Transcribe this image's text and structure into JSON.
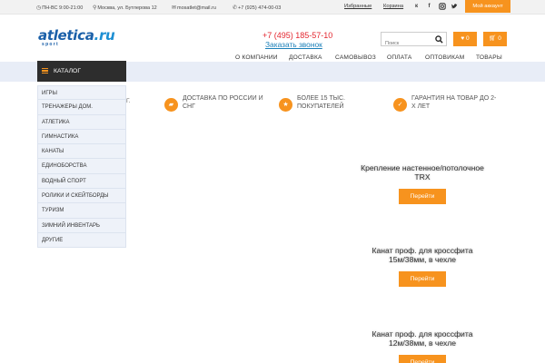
{
  "topbar": {
    "hours": "ПН-ВС 9:00-21:00",
    "address": "Москва, ул. Бутлерова 12",
    "email": "mosatlet@mail.ru",
    "phone": "+7 (925) 474-00-03",
    "favorites": "Избранные",
    "cart": "Корзина",
    "social": [
      "vk-icon",
      "facebook-icon",
      "instagram-icon",
      "twitter-icon"
    ],
    "account": "Мой аккаунт"
  },
  "header": {
    "logo_main": "atletica",
    "logo_suffix": ".ru",
    "logo_sub": "sport",
    "phone": "+7 (495) 185-57-10",
    "callback": "Заказать звонок",
    "search_placeholder": "Поиск",
    "favorites_count": "0",
    "cart_count": "0"
  },
  "nav": [
    "О КОМПАНИИ",
    "ДОСТАВКА",
    "САМОВЫВОЗ",
    "ОПЛАТА",
    "ОПТОВИКАМ",
    "ТОВАРЫ"
  ],
  "catalog": {
    "title": "КАТАЛОГ",
    "items": [
      "ИГРЫ",
      "ТРЕНАЖЕРЫ ДОМ.",
      "АТЛЕТИКА",
      "ГИМНАСТИКА",
      "КАНАТЫ",
      "ЕДИНОБОРСТВА",
      "ВОДНЫЙ СПОРТ",
      "РОЛИКИ И СКЕЙТБОРДЫ",
      "ТУРИЗМ",
      "ЗИМНИЙ ИНВЕНТАРЬ",
      "ДРУГИЕ"
    ]
  },
  "cutoff_text": "Г.",
  "features": [
    {
      "line1": "ДОСТАВКА ПО РОССИИ И",
      "line2": "СНГ"
    },
    {
      "line1": "БОЛЕЕ 15 ТЫС.",
      "line2": "ПОКУПАТЕЛЕЙ"
    },
    {
      "line1": "ГАРАНТИЯ НА ТОВАР ДО 2-",
      "line2": "Х ЛЕТ"
    }
  ],
  "products": [
    {
      "line1": "Крепление настенное/потолочное",
      "line2": "TRX",
      "button": "Перейти"
    },
    {
      "line1": "Канат проф. для кроссфита",
      "line2": "15м/38мм, в чехле",
      "button": "Перейти"
    },
    {
      "line1": "Канат проф. для кроссфита",
      "line2": "12м/38мм, в чехле",
      "button": "Перейти"
    }
  ],
  "colors": {
    "accent": "#f7931e",
    "brand": "#1a5fa8",
    "phone": "#e3262f",
    "dark": "#2d2d2d",
    "band": "#e8edf7"
  }
}
